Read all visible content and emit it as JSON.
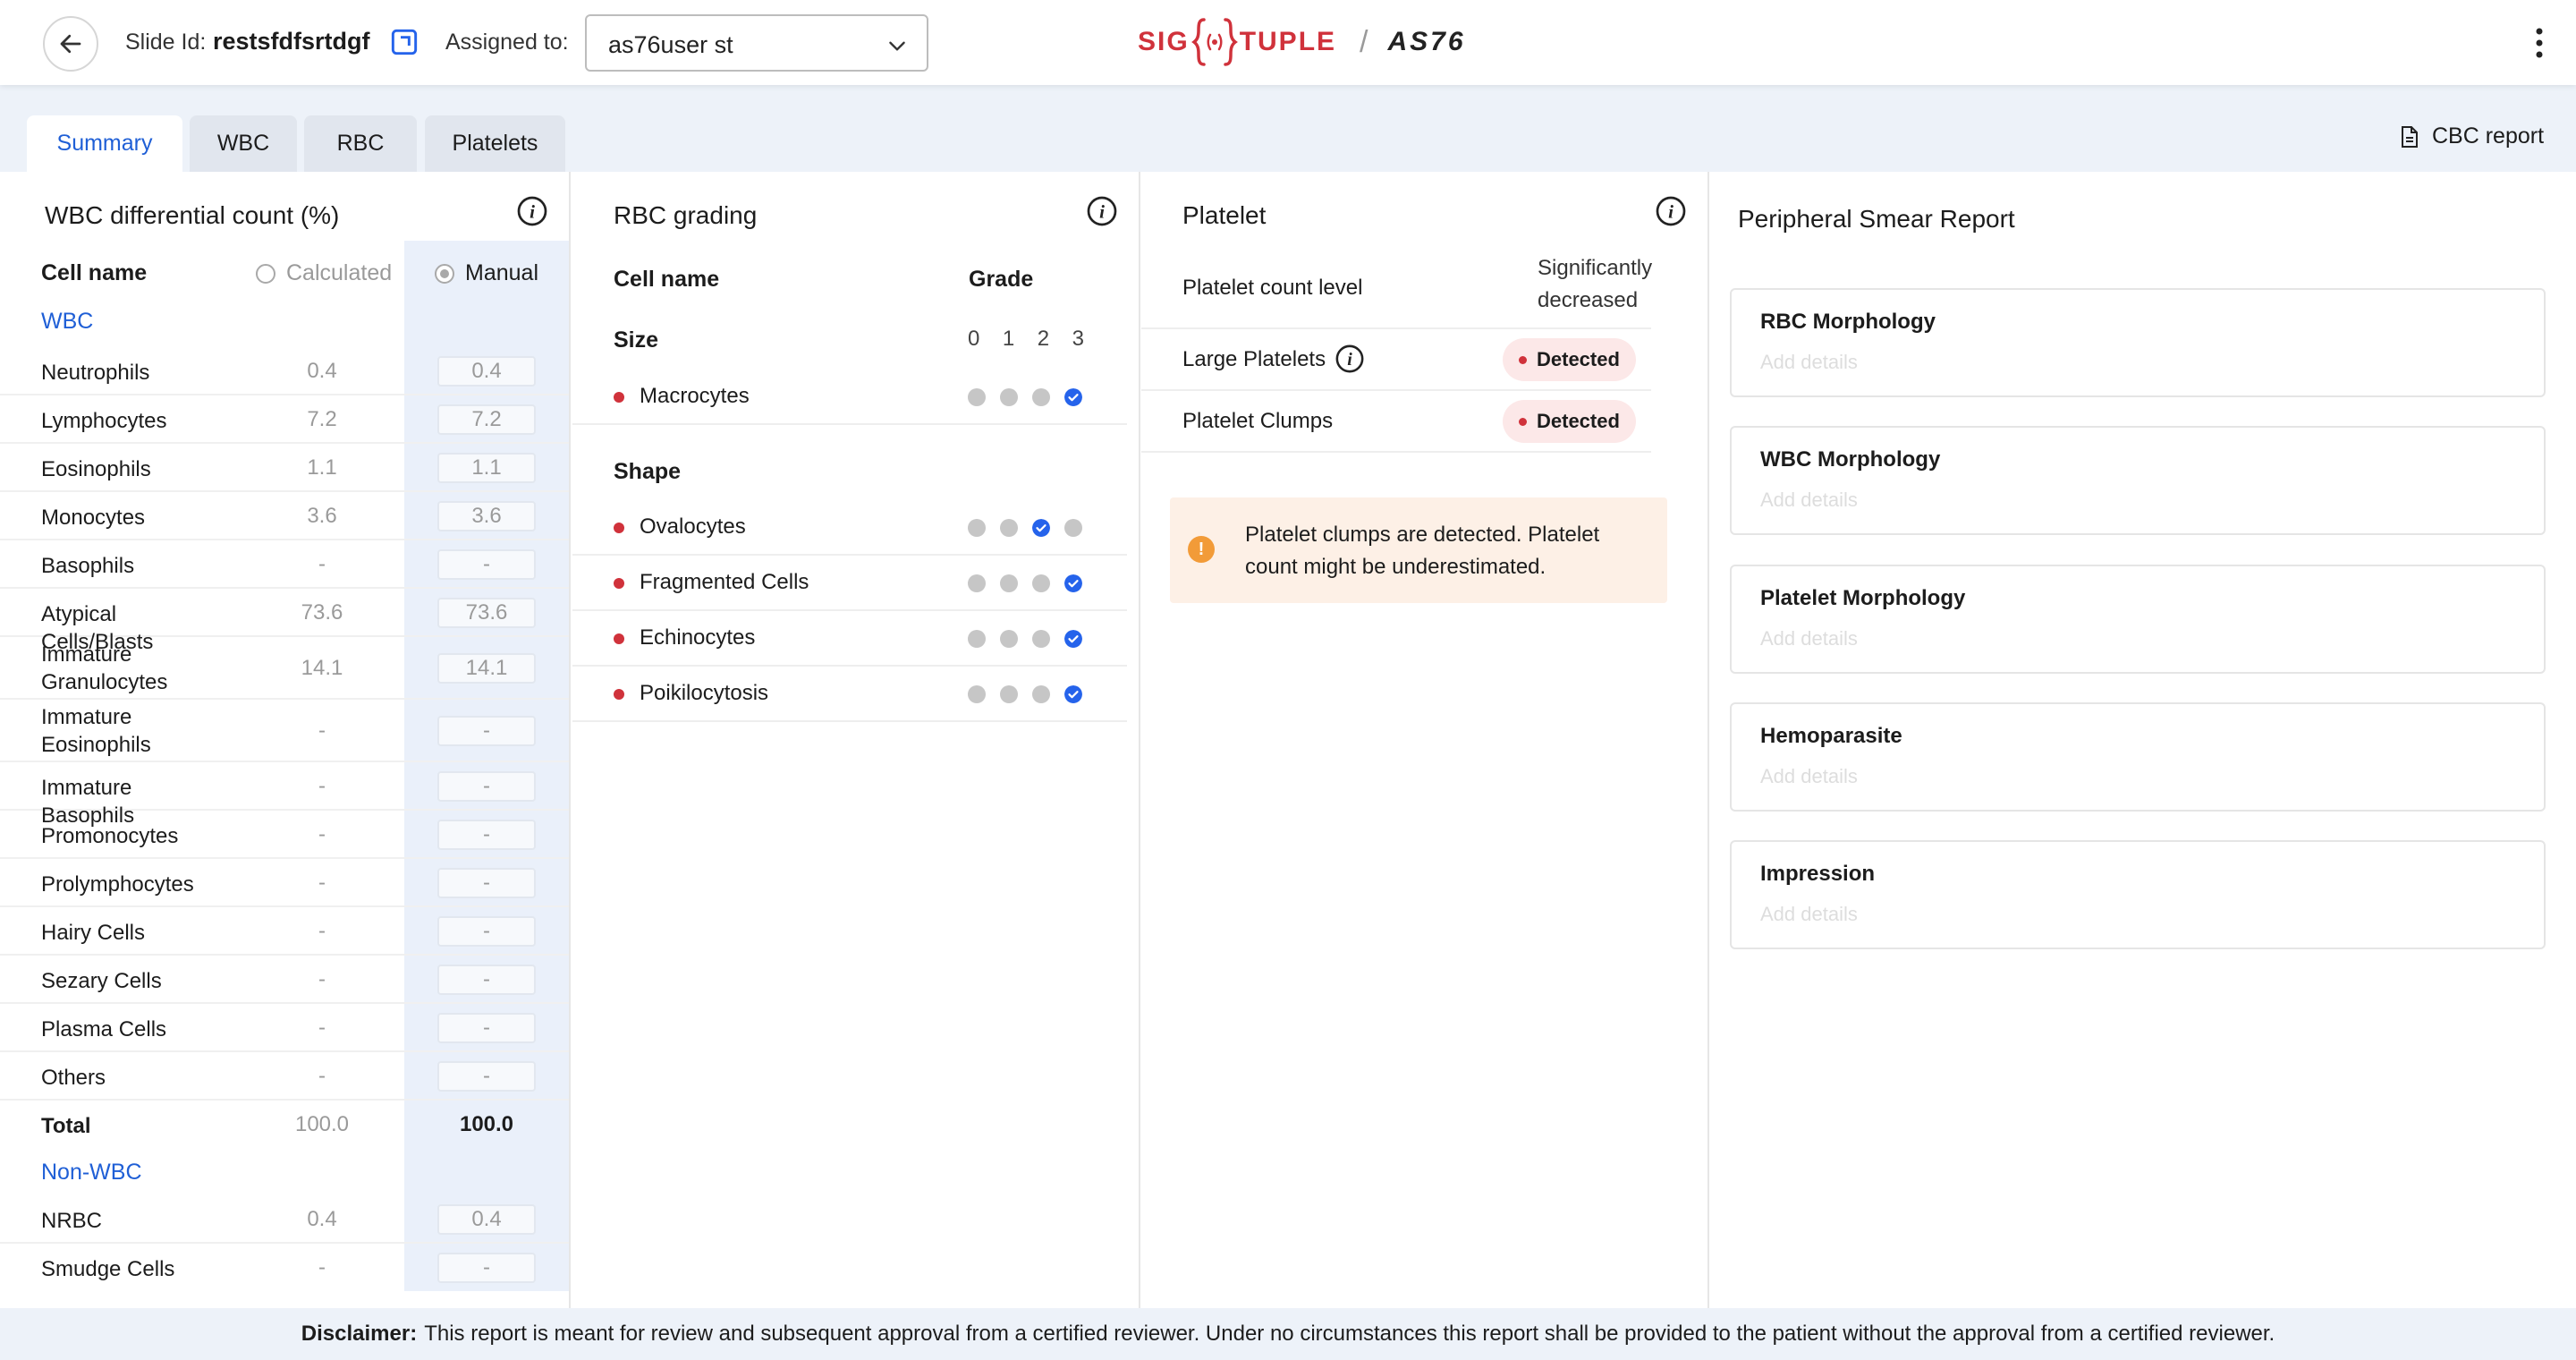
{
  "header": {
    "slide_id_label": "Slide Id:",
    "slide_id_value": "restsfdfsrtdgf",
    "assigned_label": "Assigned to:",
    "assigned_value": "as76user st",
    "logo_left": "SIG",
    "logo_right": "TUPLE",
    "logo_sep": "/",
    "logo_model": "AS76",
    "brand_color": "#d0323b"
  },
  "tabs": [
    {
      "label": "Summary",
      "active": true
    },
    {
      "label": "WBC",
      "active": false
    },
    {
      "label": "RBC",
      "active": false
    },
    {
      "label": "Platelets",
      "active": false
    }
  ],
  "cbc_report_label": "CBC report",
  "wbc": {
    "title": "WBC differential count (%)",
    "col_cell_name": "Cell name",
    "col_calculated": "Calculated",
    "col_manual": "Manual",
    "selected_mode": "Manual",
    "section_wbc": "WBC",
    "rows": [
      {
        "name": "Neutrophils",
        "calc": "0.4",
        "manual": "0.4"
      },
      {
        "name": "Lymphocytes",
        "calc": "7.2",
        "manual": "7.2"
      },
      {
        "name": "Eosinophils",
        "calc": "1.1",
        "manual": "1.1"
      },
      {
        "name": "Monocytes",
        "calc": "3.6",
        "manual": "3.6"
      },
      {
        "name": "Basophils",
        "calc": "-",
        "manual": "-"
      },
      {
        "name": "Atypical Cells/Blasts",
        "calc": "73.6",
        "manual": "73.6"
      },
      {
        "name": "Immature Granulocytes",
        "calc": "14.1",
        "manual": "14.1"
      },
      {
        "name": "Immature Eosinophils",
        "calc": "-",
        "manual": "-"
      },
      {
        "name": "Immature Basophils",
        "calc": "-",
        "manual": "-"
      },
      {
        "name": "Promonocytes",
        "calc": "-",
        "manual": "-"
      },
      {
        "name": "Prolymphocytes",
        "calc": "-",
        "manual": "-"
      },
      {
        "name": "Hairy Cells",
        "calc": "-",
        "manual": "-"
      },
      {
        "name": "Sezary Cells",
        "calc": "-",
        "manual": "-"
      },
      {
        "name": "Plasma Cells",
        "calc": "-",
        "manual": "-"
      },
      {
        "name": "Others",
        "calc": "-",
        "manual": "-"
      }
    ],
    "total": {
      "name": "Total",
      "calc": "100.0",
      "manual": "100.0"
    },
    "section_non_wbc": "Non-WBC",
    "non_wbc_rows": [
      {
        "name": "NRBC",
        "calc": "0.4",
        "manual": "0.4"
      },
      {
        "name": "Smudge Cells",
        "calc": "-",
        "manual": "-"
      }
    ]
  },
  "rbc": {
    "title": "RBC grading",
    "col_cell_name": "Cell name",
    "col_grade": "Grade",
    "grades": [
      "0",
      "1",
      "2",
      "3"
    ],
    "size_label": "Size",
    "shape_label": "Shape",
    "size_rows": [
      {
        "name": "Macrocytes",
        "grade": 3
      }
    ],
    "shape_rows": [
      {
        "name": "Ovalocytes",
        "grade": 2
      },
      {
        "name": "Fragmented Cells",
        "grade": 3
      },
      {
        "name": "Echinocytes",
        "grade": 3
      },
      {
        "name": "Poikilocytosis",
        "grade": 3
      }
    ]
  },
  "platelet": {
    "title": "Platelet",
    "count_label": "Platelet count level",
    "count_value": "Significantly decreased",
    "large_label": "Large Platelets",
    "large_status": "Detected",
    "clumps_label": "Platelet Clumps",
    "clumps_status": "Detected",
    "alert_text": "Platelet clumps are detected. Platelet count might be underestimated.",
    "alert_color": "#f29b38"
  },
  "smear": {
    "title": "Peripheral Smear Report",
    "placeholder": "Add details",
    "sections": [
      {
        "title": "RBC Morphology"
      },
      {
        "title": "WBC Morphology"
      },
      {
        "title": "Platelet Morphology"
      },
      {
        "title": "Hemoparasite"
      },
      {
        "title": "Impression"
      }
    ]
  },
  "disclaimer": {
    "label": "Disclaimer:",
    "text": "This report is meant for review and subsequent approval from a certified reviewer. Under no circumstances this report shall be provided to the patient without the approval from a certified reviewer."
  }
}
